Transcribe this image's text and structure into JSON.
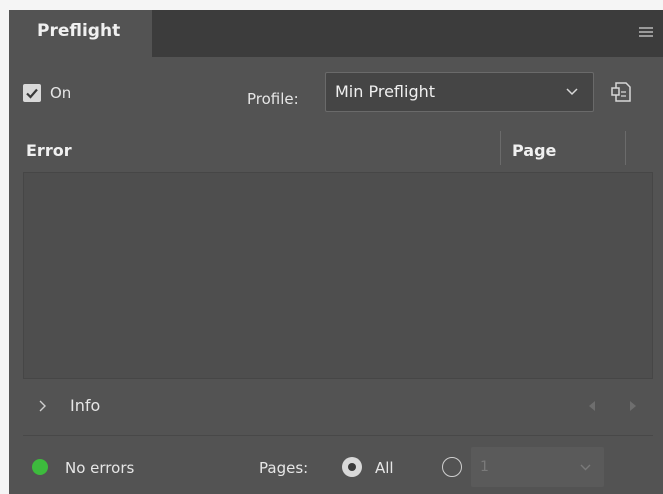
{
  "panel": {
    "tab_title": "Preflight",
    "menu_icon": "hamburger-menu-icon"
  },
  "controls": {
    "on_checked": true,
    "on_label": "On",
    "profile_label": "Profile:",
    "profile_value": "Min Preflight",
    "profiles_icon": "define-profiles-icon"
  },
  "error_table": {
    "columns": [
      "Error",
      "Page"
    ],
    "rows": []
  },
  "info": {
    "label": "Info",
    "prev_icon": "triangle-left-icon",
    "next_icon": "triangle-right-icon"
  },
  "footer": {
    "status_text": "No errors",
    "status_color": "#3dbb3d",
    "pages_label": "Pages:",
    "all_label": "All",
    "all_selected": true,
    "range_value": "1"
  }
}
